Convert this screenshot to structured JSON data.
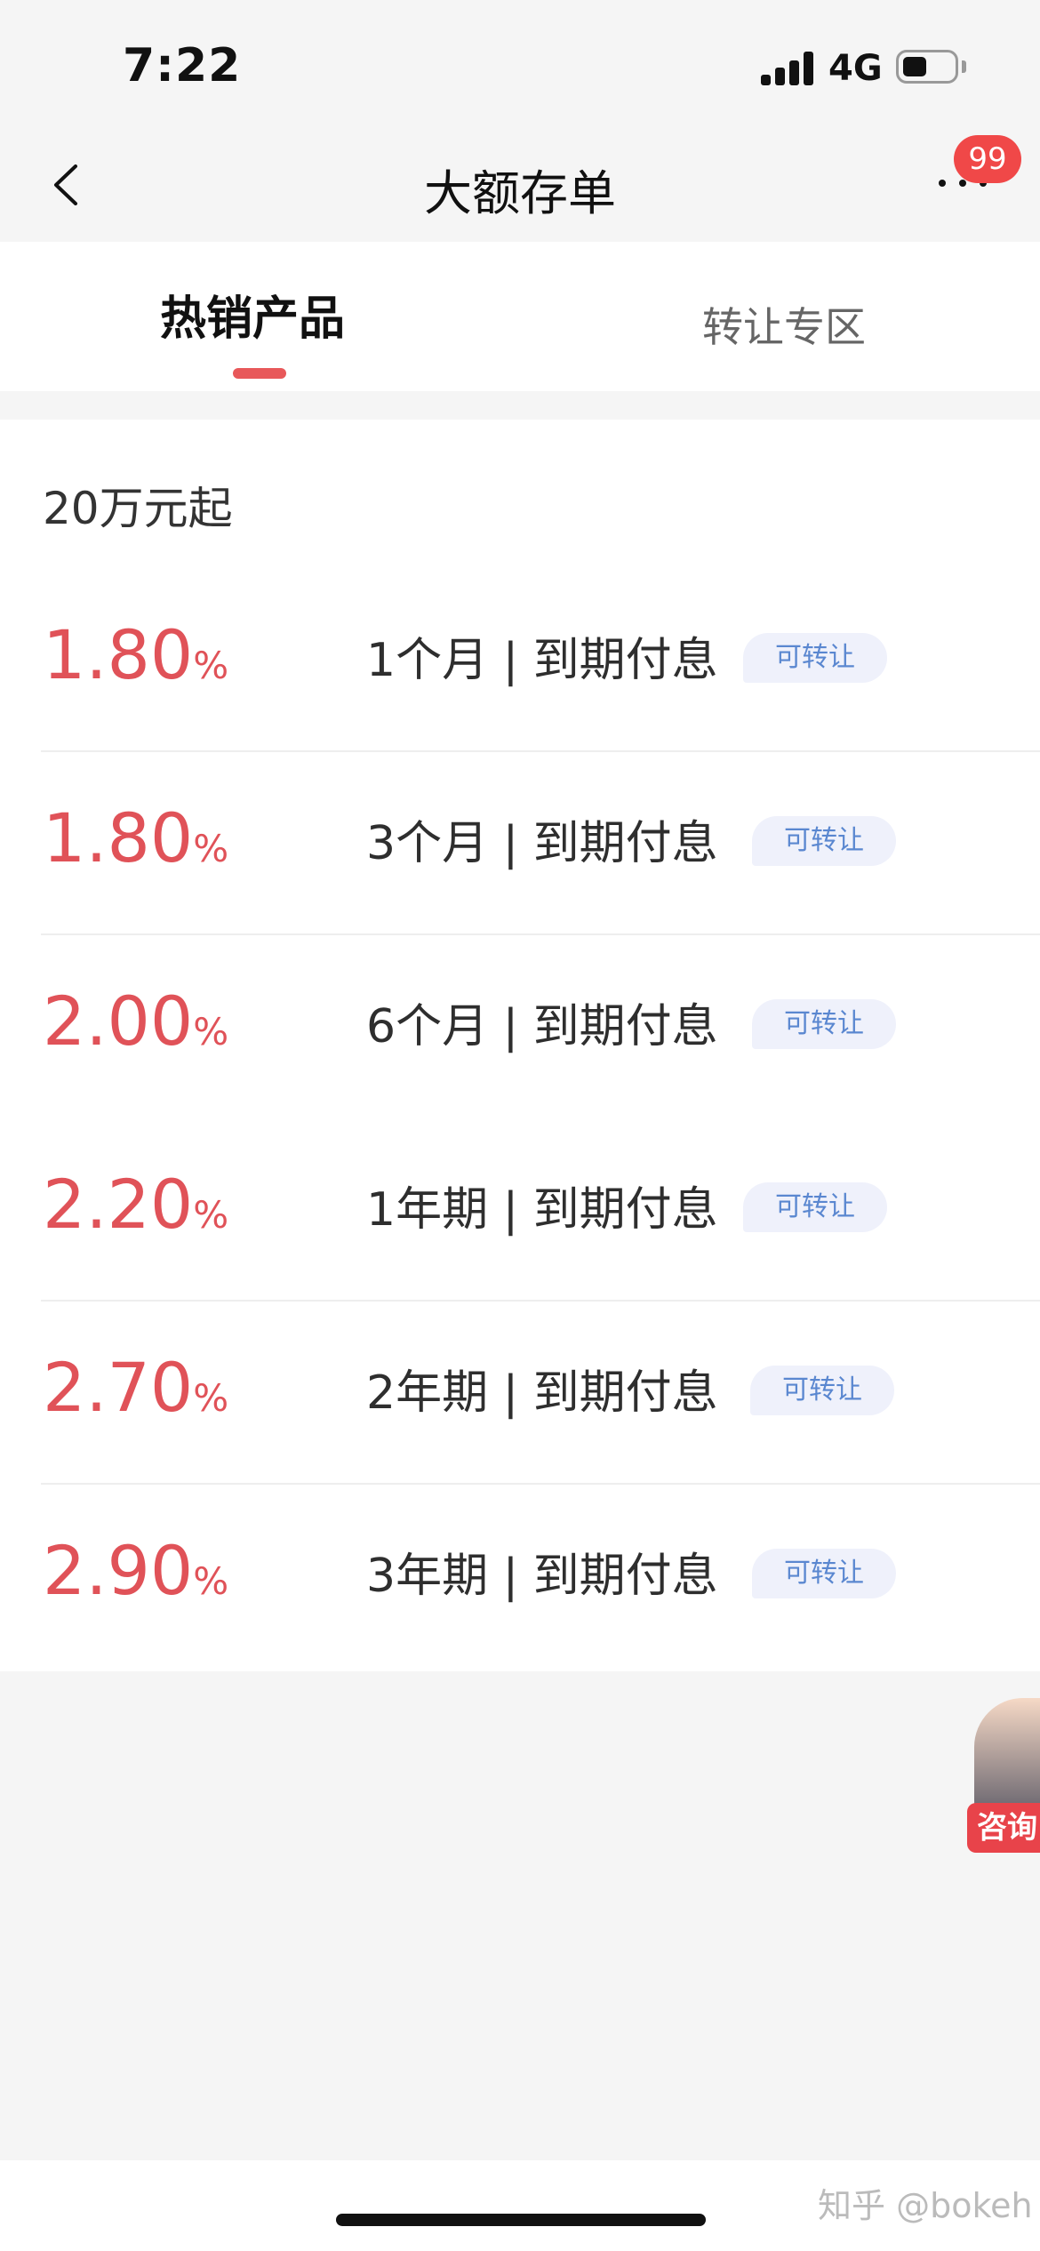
{
  "status_bar": {
    "time": "7:22",
    "network": "4G"
  },
  "nav": {
    "title": "大额存单",
    "badge": "99"
  },
  "tabs": [
    {
      "label": "热销产品",
      "active": true
    },
    {
      "label": "转让专区",
      "active": false
    }
  ],
  "section": {
    "title": "20万元起"
  },
  "products": [
    {
      "rate": "1.80",
      "unit": "%",
      "term": "1个月 | 到期付息",
      "tag": "可转让"
    },
    {
      "rate": "1.80",
      "unit": "%",
      "term": "3个月 | 到期付息",
      "tag": "可转让"
    },
    {
      "rate": "2.00",
      "unit": "%",
      "term": "6个月 | 到期付息",
      "tag": "可转让"
    },
    {
      "rate": "2.20",
      "unit": "%",
      "term": "1年期 | 到期付息",
      "tag": "可转让"
    },
    {
      "rate": "2.70",
      "unit": "%",
      "term": "2年期 | 到期付息",
      "tag": "可转让"
    },
    {
      "rate": "2.90",
      "unit": "%",
      "term": "3年期 | 到期付息",
      "tag": "可转让"
    }
  ],
  "consult": {
    "label": "咨询"
  },
  "watermark": "知乎 @bokeh",
  "colors": {
    "accent": "#e05258",
    "tag_text": "#5a87d0",
    "tag_bg": "#eff1fb",
    "badge": "#f04848"
  }
}
